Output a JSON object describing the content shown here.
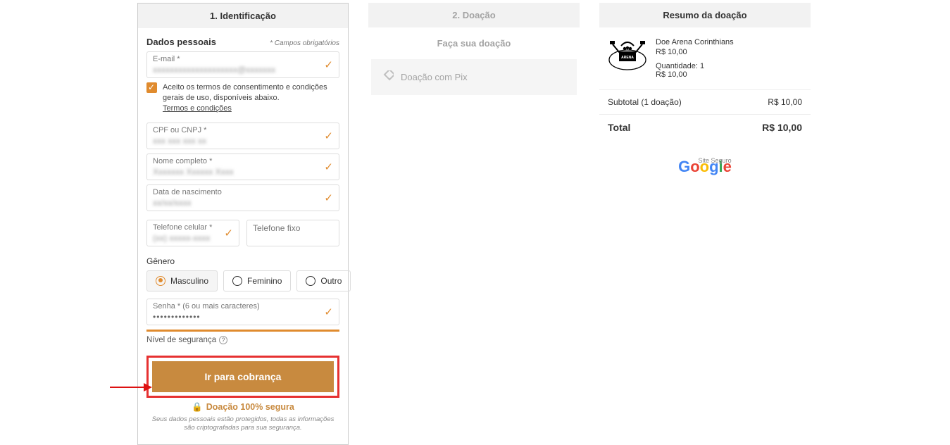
{
  "step1": {
    "header": "1. Identificação",
    "sectionTitle": "Dados pessoais",
    "requiredNote": "* Campos obrigatórios",
    "email": {
      "label": "E-mail *"
    },
    "consent": {
      "text": "Aceito os termos de consentimento e condições gerais de uso, disponíveis abaixo.",
      "link": "Termos e condições"
    },
    "cpf": {
      "label": "CPF ou CNPJ *"
    },
    "name": {
      "label": "Nome completo *"
    },
    "birth": {
      "label": "Data de nascimento"
    },
    "cell": {
      "label": "Telefone celular *"
    },
    "landline": {
      "placeholder": "Telefone fixo"
    },
    "genderLabel": "Gênero",
    "gender": {
      "m": "Masculino",
      "f": "Feminino",
      "o": "Outro"
    },
    "password": {
      "label": "Senha * (6 ou mais caracteres)",
      "value": "•••••••••••••"
    },
    "secLevel": "Nível de segurança",
    "cta": "Ir para cobrança",
    "secureLine": "Doação 100% segura",
    "secureNote": "Seus dados pessoais estão protegidos, todas as informações são criptografadas para sua segurança."
  },
  "step2": {
    "header": "2. Doação",
    "sub": "Faça sua doação",
    "pix": "Doação com Pix"
  },
  "summary": {
    "header": "Resumo da doação",
    "item": {
      "name": "Doe Arena Corinthians",
      "price": "R$ 10,00",
      "qty": "Quantidade: 1",
      "line": "R$ 10,00"
    },
    "subtotalLabel": "Subtotal (1 doação)",
    "subtotalValue": "R$ 10,00",
    "totalLabel": "Total",
    "totalValue": "R$ 10,00",
    "safeSite": "Site Seguro"
  }
}
